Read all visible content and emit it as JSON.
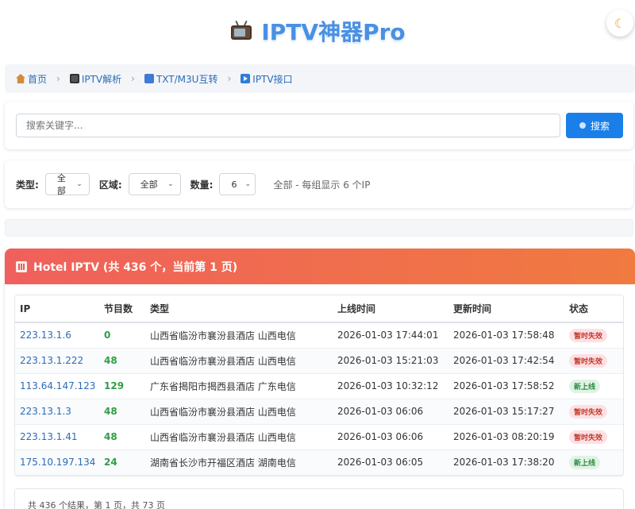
{
  "header": {
    "title": "IPTV神器Pro",
    "tv_icon": "tv-icon",
    "theme_icon": "moon-icon"
  },
  "breadcrumb": [
    {
      "label": "首页",
      "icon": "home-icon"
    },
    {
      "label": "IPTV解析",
      "icon": "tv-icon"
    },
    {
      "label": "TXT/M3U互转",
      "icon": "swap-icon"
    },
    {
      "label": "IPTV接口",
      "icon": "play-icon"
    }
  ],
  "search": {
    "placeholder": "搜索关键字...",
    "button_label": "搜索"
  },
  "filters": {
    "type_label": "类型:",
    "type_value": "全部",
    "region_label": "区域:",
    "region_value": "全部",
    "count_label": "数量:",
    "count_value": "6",
    "summary": "全部 - 每组显示 6 个IP"
  },
  "panel": {
    "title": "Hotel IPTV (共 436 个，当前第 1 页)",
    "columns": [
      "IP",
      "节目数",
      "类型",
      "上线时间",
      "更新时间",
      "状态"
    ],
    "rows": [
      {
        "ip": "223.13.1.6",
        "count": "0",
        "type": "山西省临汾市襄汾县酒店 山西电信",
        "online": "2026-01-03 17:44:01",
        "updated": "2026-01-03 17:58:48",
        "status": "暂时失效",
        "status_kind": "fail"
      },
      {
        "ip": "223.13.1.222",
        "count": "48",
        "type": "山西省临汾市襄汾县酒店 山西电信",
        "online": "2026-01-03 15:21:03",
        "updated": "2026-01-03 17:42:54",
        "status": "暂时失效",
        "status_kind": "fail"
      },
      {
        "ip": "113.64.147.123",
        "count": "129",
        "type": "广东省揭阳市揭西县酒店 广东电信",
        "online": "2026-01-03 10:32:12",
        "updated": "2026-01-03 17:58:52",
        "status": "新上线",
        "status_kind": "new"
      },
      {
        "ip": "223.13.1.3",
        "count": "48",
        "type": "山西省临汾市襄汾县酒店 山西电信",
        "online": "2026-01-03 06:06",
        "updated": "2026-01-03 15:17:27",
        "status": "暂时失效",
        "status_kind": "fail"
      },
      {
        "ip": "223.13.1.41",
        "count": "48",
        "type": "山西省临汾市襄汾县酒店 山西电信",
        "online": "2026-01-03 06:06",
        "updated": "2026-01-03 08:20:19",
        "status": "暂时失效",
        "status_kind": "fail"
      },
      {
        "ip": "175.10.197.134",
        "count": "24",
        "type": "湖南省长沙市开福区酒店 湖南电信",
        "online": "2026-01-03 06:05",
        "updated": "2026-01-03 17:38:20",
        "status": "新上线",
        "status_kind": "new"
      }
    ],
    "footer": "共 436 个结果，第 1 页，共 73 页"
  },
  "colors": {
    "accent": "#1a7fe8",
    "title": "#4a90e2",
    "panel_head_start": "#f0605c",
    "panel_head_end": "#f07a40",
    "ok": "#2e9e45"
  }
}
